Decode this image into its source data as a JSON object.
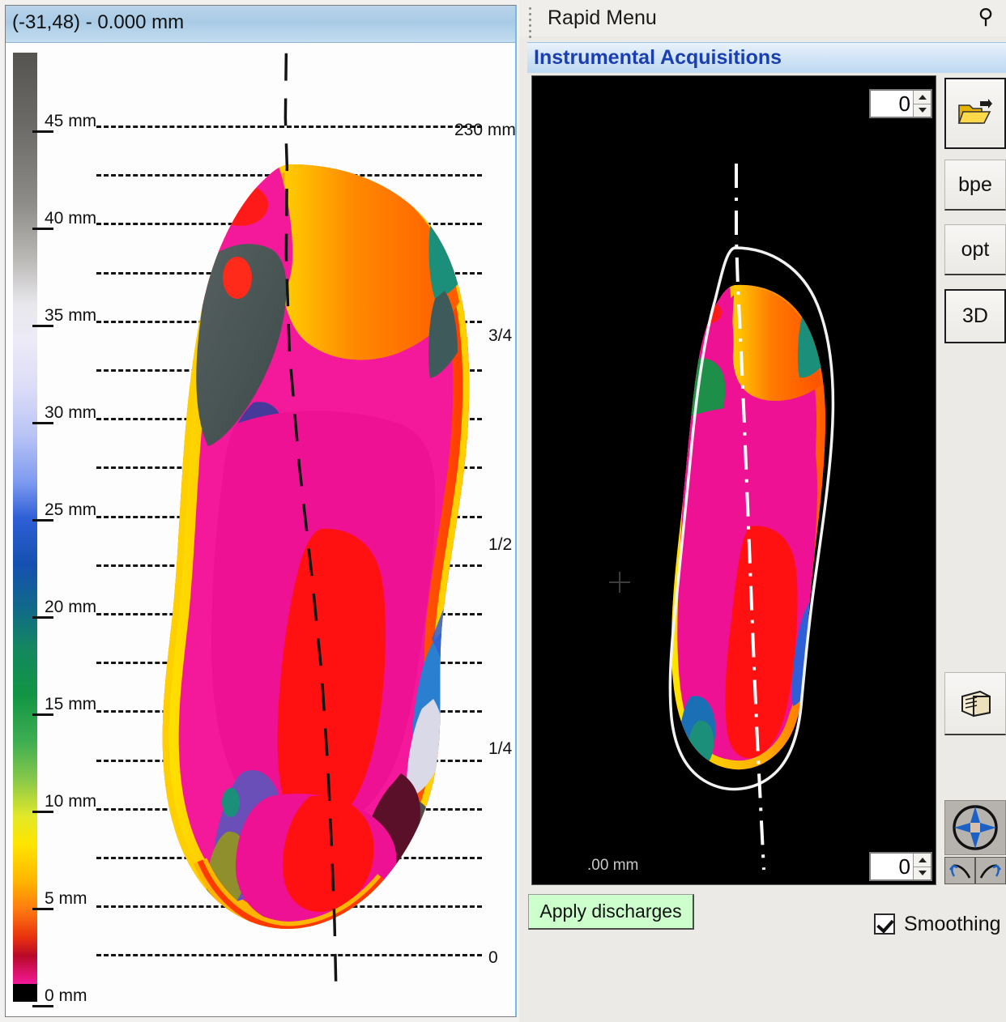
{
  "left_panel": {
    "titlebar": {
      "coordinates": "(-31,48)",
      "separator": "-",
      "value": "0.000 mm",
      "full_text": "(-31,48) - 0.000 mm"
    },
    "colorbar": {
      "unit": "mm",
      "ticks": [
        {
          "label": "45 mm",
          "value": 45
        },
        {
          "label": "40 mm",
          "value": 40
        },
        {
          "label": "35 mm",
          "value": 35
        },
        {
          "label": "30 mm",
          "value": 30
        },
        {
          "label": "25 mm",
          "value": 25
        },
        {
          "label": "20 mm",
          "value": 20
        },
        {
          "label": "15 mm",
          "value": 15
        },
        {
          "label": "10 mm",
          "value": 10
        },
        {
          "label": "5 mm",
          "value": 5
        },
        {
          "label": "0 mm",
          "value": 0
        }
      ],
      "stops": [
        {
          "pos": 0,
          "color": "#565451"
        },
        {
          "pos": 8,
          "color": "#6d6b68"
        },
        {
          "pos": 16,
          "color": "#8d8b88"
        },
        {
          "pos": 22,
          "color": "#b9b7b4"
        },
        {
          "pos": 27,
          "color": "#e8e7ec"
        },
        {
          "pos": 31,
          "color": "#eceaf6"
        },
        {
          "pos": 36,
          "color": "#dcdcf7"
        },
        {
          "pos": 41,
          "color": "#b9c4f5"
        },
        {
          "pos": 46,
          "color": "#7f9cf0"
        },
        {
          "pos": 50,
          "color": "#2f5fd6"
        },
        {
          "pos": 55,
          "color": "#1450b0"
        },
        {
          "pos": 60,
          "color": "#116b86"
        },
        {
          "pos": 64,
          "color": "#13885f"
        },
        {
          "pos": 69,
          "color": "#119544"
        },
        {
          "pos": 74,
          "color": "#3fae52"
        },
        {
          "pos": 78,
          "color": "#86c84a"
        },
        {
          "pos": 82,
          "color": "#e2e829"
        },
        {
          "pos": 85,
          "color": "#ffe500"
        },
        {
          "pos": 89,
          "color": "#ffb400"
        },
        {
          "pos": 92,
          "color": "#ff7a10"
        },
        {
          "pos": 95,
          "color": "#e8310f"
        },
        {
          "pos": 97,
          "color": "#b80a28"
        },
        {
          "pos": 100,
          "color": "#f4189a"
        }
      ],
      "black_cap": "#000000"
    },
    "right_labels": [
      {
        "label": "230 mm"
      },
      {
        "label": "3/4"
      },
      {
        "label": "1/2"
      },
      {
        "label": "1/4"
      },
      {
        "label": "0"
      }
    ]
  },
  "right_panel": {
    "rapid_menu_title": "Rapid Menu",
    "pin_icon": "pin-icon",
    "section_header": "Instrumental Acquisitions",
    "viewport": {
      "scale_label": ".00 mm",
      "background": "#000000"
    },
    "spinner_top": {
      "value": "0"
    },
    "spinner_bottom": {
      "value": "0"
    },
    "toolbar_buttons": [
      {
        "name": "open-file-button",
        "label": "",
        "icon": "folder-open-icon"
      },
      {
        "name": "bpe-button",
        "label": "bpe",
        "icon": ""
      },
      {
        "name": "opt-button",
        "label": "opt",
        "icon": ""
      },
      {
        "name": "3d-button",
        "label": "3D",
        "icon": ""
      }
    ],
    "print_button": {
      "label": "",
      "icon": "print-book-icon"
    },
    "navpad": {
      "icon": "four-way-compass-icon"
    },
    "rotate_left": {
      "icon": "rotate-left-icon"
    },
    "rotate_right": {
      "icon": "rotate-right-icon"
    },
    "apply_discharges_label": "Apply discharges",
    "smoothing": {
      "label": "Smoothing",
      "checked": true
    }
  },
  "colors": {
    "accent_blue": "#1b3fb0",
    "apply_button_green": "#ccffcc",
    "panel_bg": "#eceae6",
    "titlebar_blue": "#a9cbe6"
  }
}
